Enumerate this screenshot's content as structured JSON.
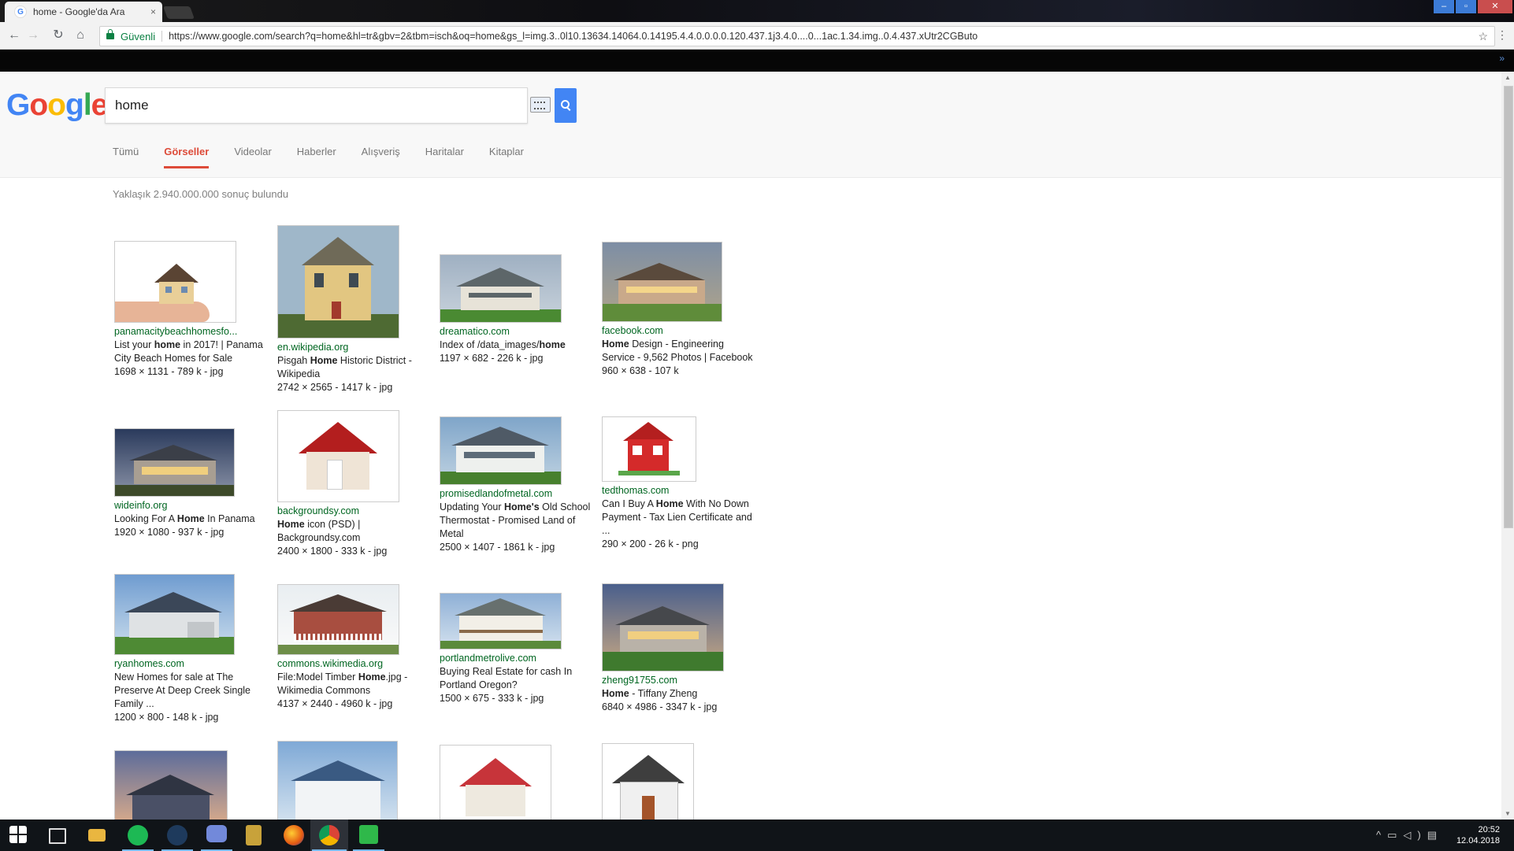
{
  "browser": {
    "tab_title": "home - Google'da Ara",
    "tab_close": "×",
    "secure_label": "Güvenli",
    "url": "https://www.google.com/search?q=home&hl=tr&gbv=2&tbm=isch&oq=home&gs_l=img.3..0l10.13634.14064.0.14195.4.4.0.0.0.0.120.437.1j3.4.0....0...1ac.1.34.img..0.4.437.xUtr2CGButo",
    "bookmarks_more": "»"
  },
  "google": {
    "logo": [
      "G",
      "o",
      "o",
      "g",
      "l",
      "e"
    ],
    "query": "home",
    "tabs": [
      "Tümü",
      "Görseller",
      "Videolar",
      "Haberler",
      "Alışveriş",
      "Haritalar",
      "Kitaplar"
    ],
    "active_tab": "Görseller",
    "result_stats": "Yaklaşık 2.940.000.000 sonuç bulundu"
  },
  "results": [
    {
      "source": "panamacitybeachhomesfo...",
      "title_pre": "List your ",
      "title_bold": "home",
      "title_post": " in 2017! | Panama City Beach Homes for Sale",
      "meta": "1698 × 1131 - 789 k - jpg"
    },
    {
      "source": "en.wikipedia.org",
      "title_pre": "Pisgah ",
      "title_bold": "Home",
      "title_post": " Historic District - Wikipedia",
      "meta": "2742 × 2565 - 1417 k - jpg"
    },
    {
      "source": "dreamatico.com",
      "title_pre": "Index of /data_images/",
      "title_bold": "home",
      "title_post": "",
      "meta": "1197 × 682 - 226 k - jpg"
    },
    {
      "source": "facebook.com",
      "title_pre": "",
      "title_bold": "Home",
      "title_post": " Design - Engineering Service - 9,562 Photos | Facebook",
      "meta": "960 × 638 - 107 k"
    },
    {
      "source": "wideinfo.org",
      "title_pre": "Looking For A ",
      "title_bold": "Home",
      "title_post": " In Panama",
      "meta": "1920 × 1080 - 937 k - jpg"
    },
    {
      "source": "backgroundsy.com",
      "title_pre": "",
      "title_bold": "Home",
      "title_post": " icon (PSD) | Backgroundsy.com",
      "meta": "2400 × 1800 - 333 k - jpg"
    },
    {
      "source": "promisedlandofmetal.com",
      "title_pre": "Updating Your ",
      "title_bold": "Home's",
      "title_post": " Old School Thermostat - Promised Land of Metal",
      "meta": "2500 × 1407 - 1861 k - jpg"
    },
    {
      "source": "tedthomas.com",
      "title_pre": "Can I Buy A ",
      "title_bold": "Home",
      "title_post": " With No Down Payment - Tax Lien Certificate and ...",
      "meta": "290 × 200 - 26 k - png"
    },
    {
      "source": "ryanhomes.com",
      "title_pre": "New Homes for sale at The Preserve At Deep Creek Single Family ...",
      "title_bold": "",
      "title_post": "",
      "meta": "1200 × 800 - 148 k - jpg"
    },
    {
      "source": "commons.wikimedia.org",
      "title_pre": "File:Model Timber ",
      "title_bold": "Home",
      "title_post": ".jpg - Wikimedia Commons",
      "meta": "4137 × 2440 - 4960 k - jpg"
    },
    {
      "source": "portlandmetrolive.com",
      "title_pre": "Buying Real Estate for cash In Portland Oregon?",
      "title_bold": "",
      "title_post": "",
      "meta": "1500 × 675 - 333 k - jpg"
    },
    {
      "source": "zheng91755.com",
      "title_pre": "",
      "title_bold": "Home",
      "title_post": " - Tiffany Zheng",
      "meta": "6840 × 4986 - 3347 k - jpg"
    }
  ],
  "taskbar": {
    "time": "20:52",
    "date": "12.04.2018"
  },
  "colors": {
    "google_blue": "#4285f4",
    "google_red": "#ea4335",
    "google_yellow": "#fbbc05",
    "google_green": "#34a853",
    "active_tab": "#dd4b39",
    "source_green": "#006621"
  }
}
